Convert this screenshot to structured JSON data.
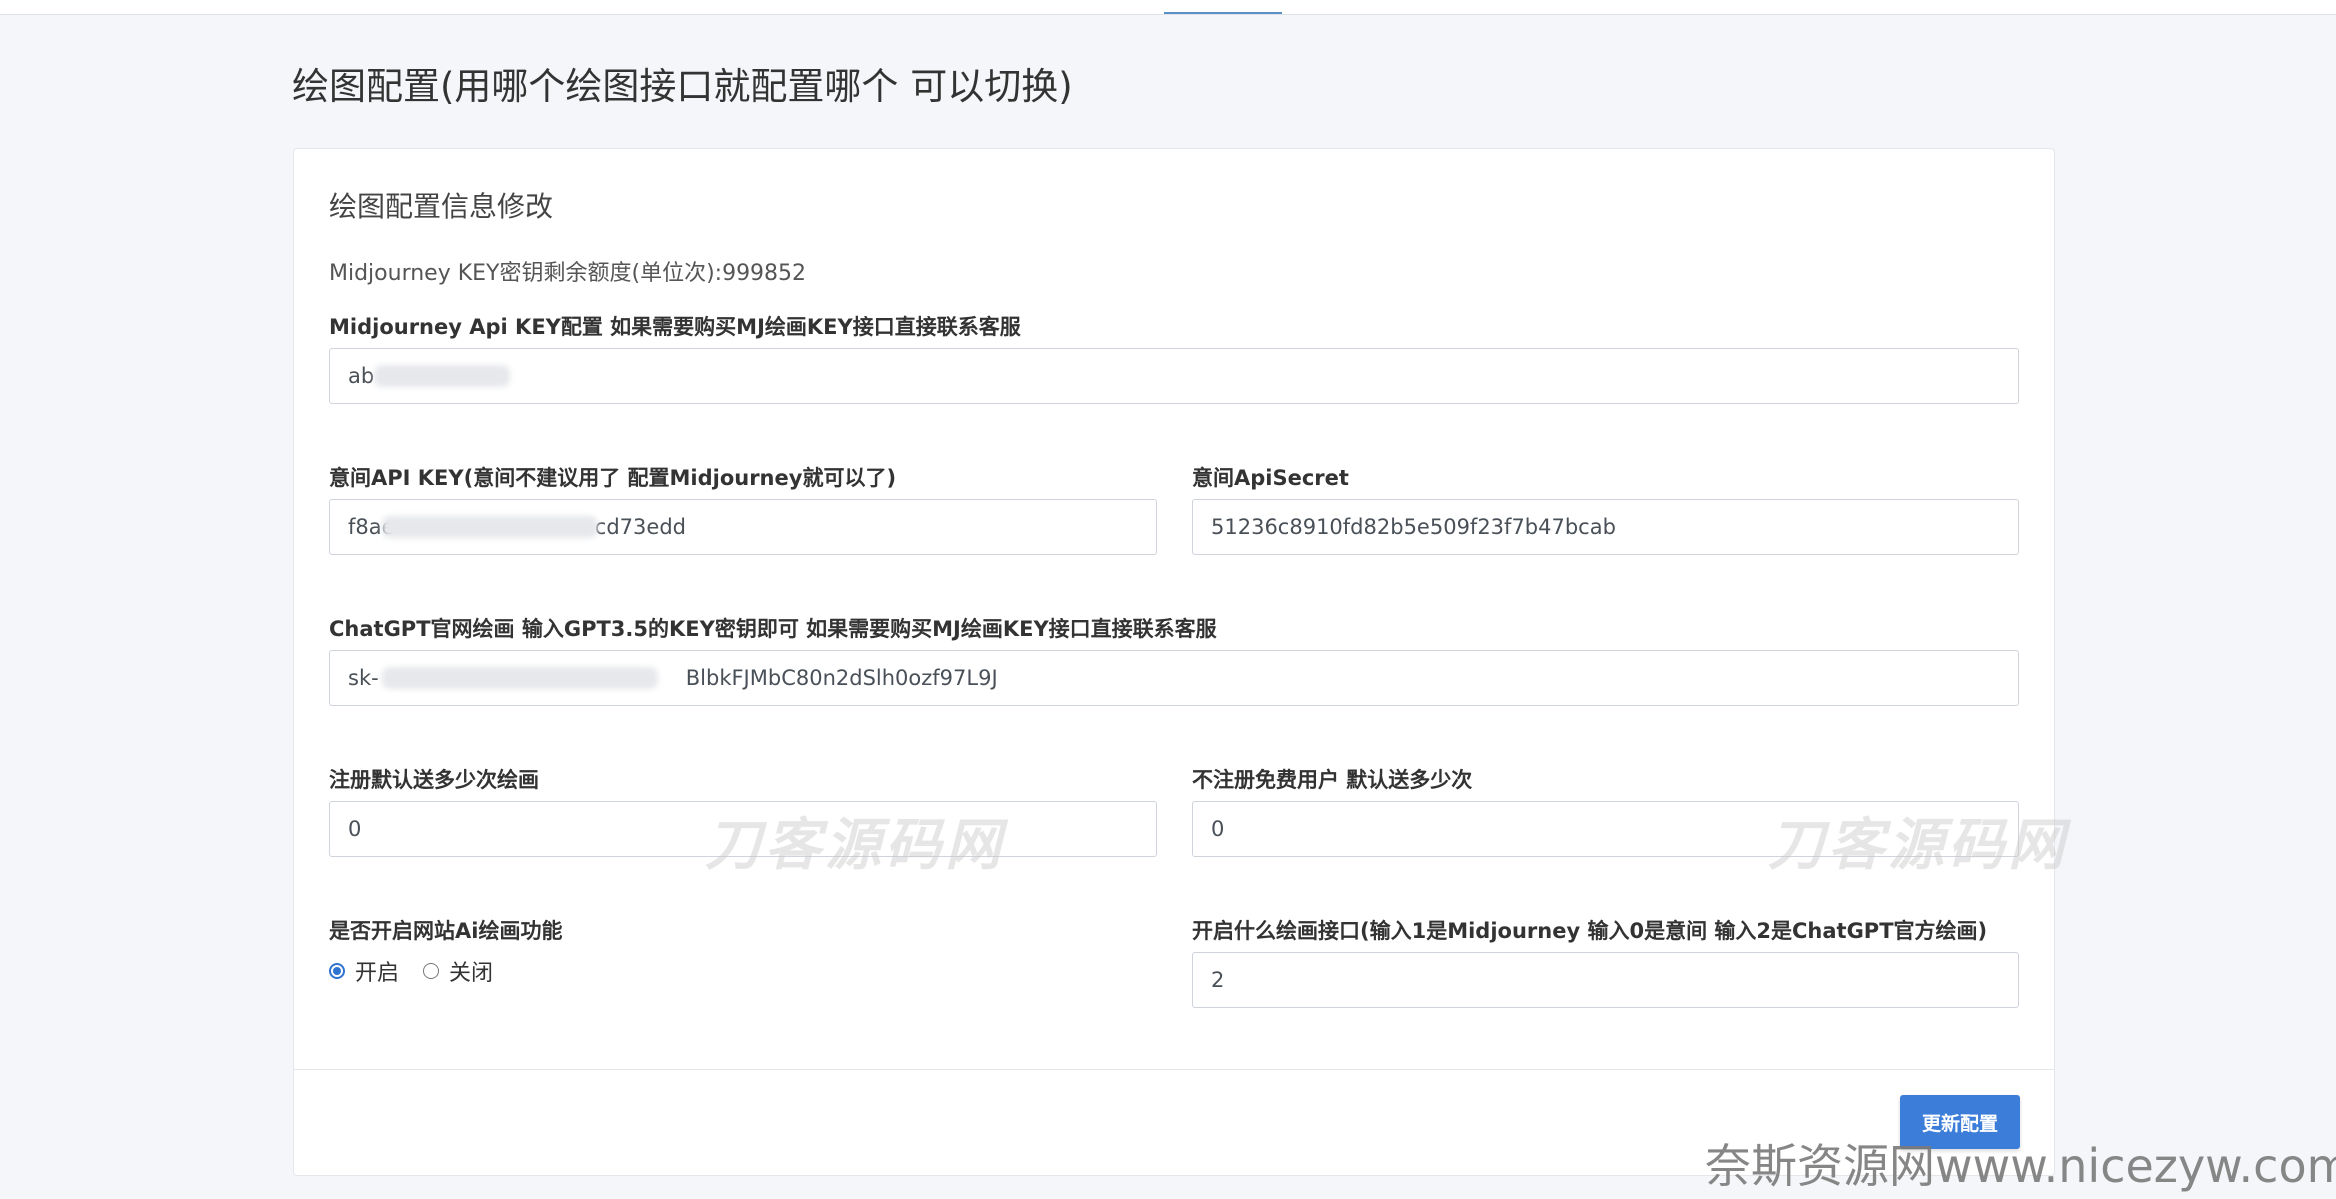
{
  "page": {
    "title": "绘图配置(用哪个绘图接口就配置哪个 可以切换)"
  },
  "card": {
    "title": "绘图配置信息修改",
    "quota_text": "Midjourney KEY密钥剩余额度(单位次):999852"
  },
  "fields": {
    "mj_key": {
      "label": "Midjourney Api KEY配置 如果需要购买MJ绘画KEY接口直接联系客服",
      "value": "ab"
    },
    "yijian_key": {
      "label": "意间API KEY(意间不建议用了 配置Midjourney就可以了)",
      "value": "f8ae                              cd73edd"
    },
    "yijian_secret": {
      "label": "意间ApiSecret",
      "value": "51236c8910fd82b5e509f23f7b47bcab"
    },
    "chatgpt_key": {
      "label": "ChatGPT官网绘画 输入GPT3.5的KEY密钥即可 如果需要购买MJ绘画KEY接口直接联系客服",
      "value": "sk-                                              BlbkFJMbC80n2dSlh0ozf97L9J"
    },
    "register_default": {
      "label": "注册默认送多少次绘画",
      "value": "0"
    },
    "guest_default": {
      "label": "不注册免费用户 默认送多少次",
      "value": "0"
    },
    "enable_ai_draw": {
      "label": "是否开启网站Ai绘画功能",
      "options": [
        "开启",
        "关闭"
      ],
      "selected": "开启"
    },
    "draw_api": {
      "label": "开启什么绘画接口(输入1是Midjourney 输入0是意间 输入2是ChatGPT官方绘画)",
      "value": "2"
    }
  },
  "actions": {
    "update_label": "更新配置"
  },
  "watermarks": {
    "center": "刀客源码网",
    "right": "刀客源码网",
    "corner": "奈斯资源网www.nicezyw.com"
  },
  "colors": {
    "accent": "#3b7dd8",
    "background": "#f4f6f9"
  }
}
